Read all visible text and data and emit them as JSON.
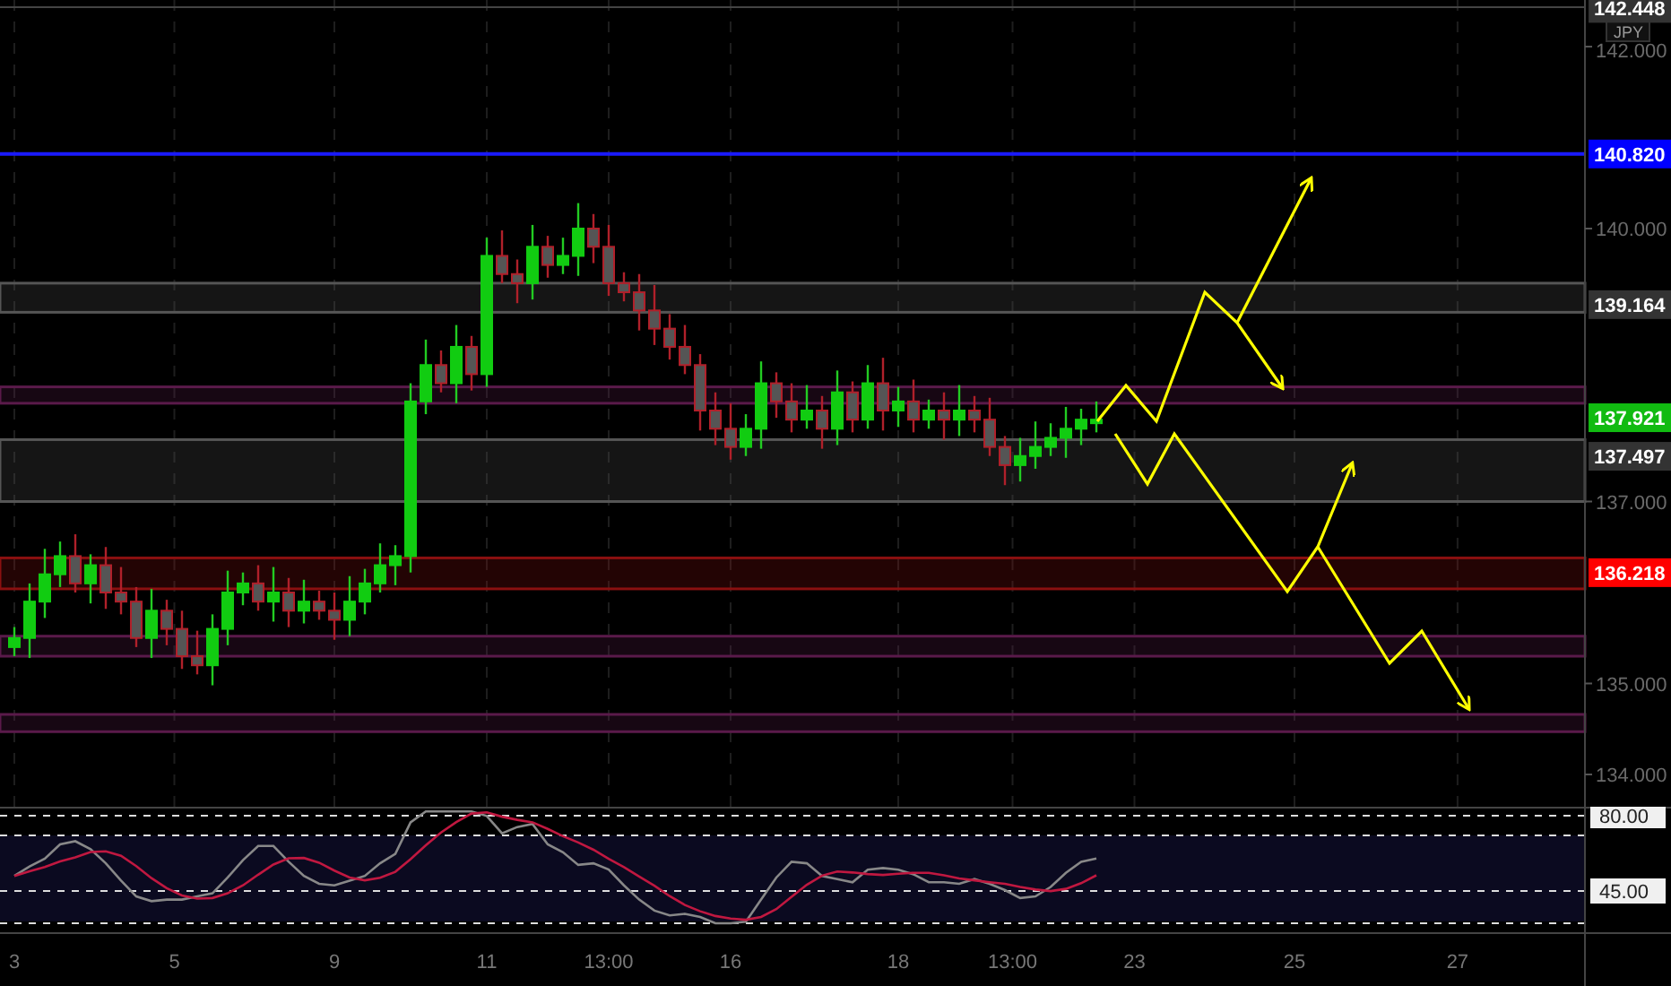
{
  "price_chart": {
    "currency": "JPY",
    "price_axis_labels": [
      "142.000",
      "140.000",
      "137.000",
      "135.000",
      "134.000"
    ],
    "time_axis_labels": [
      "3",
      "5",
      "9",
      "11",
      "13:00",
      "16",
      "18",
      "13:00",
      "23",
      "25",
      "27"
    ],
    "price_tags": [
      {
        "label": "142.448",
        "color": "#333333"
      },
      {
        "label": "140.820",
        "color": "#0000ff"
      },
      {
        "label": "139.164",
        "color": "#333333"
      },
      {
        "label": "137.921",
        "color": "#11bb11"
      },
      {
        "label": "137.497",
        "color": "#333333"
      },
      {
        "label": "136.218",
        "color": "#ff0000"
      }
    ]
  },
  "rsi_pane": {
    "levels": [
      {
        "label": "80.00"
      },
      {
        "label": "45.00"
      }
    ]
  }
}
